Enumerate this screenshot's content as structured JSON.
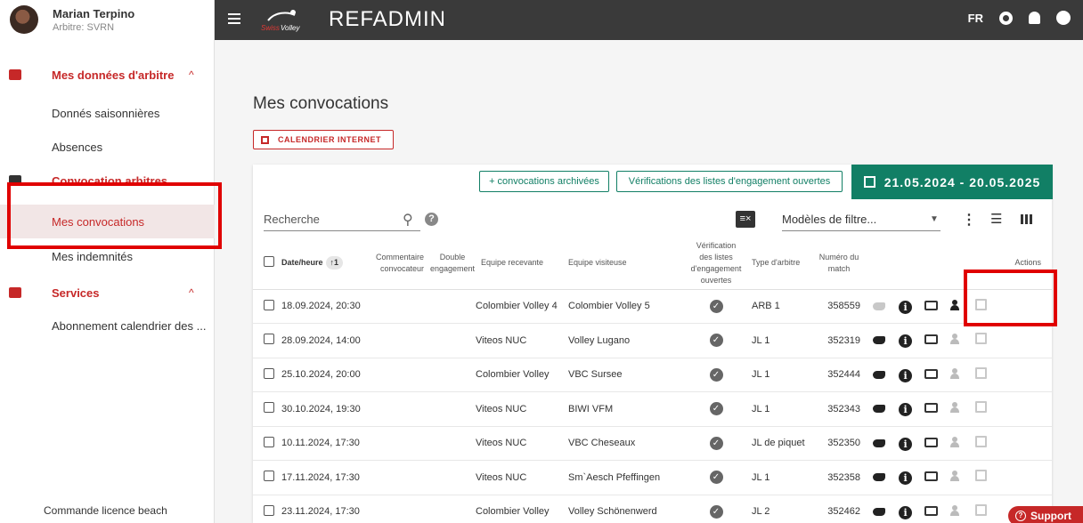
{
  "user": {
    "name": "Marian Terpino",
    "role": "Arbitre: SVRN"
  },
  "sidebar": {
    "sections": [
      {
        "title": "Mes données d'arbitre",
        "items": [
          "Donnés saisonnières",
          "Absences"
        ]
      },
      {
        "title": "Convocation arbitres",
        "items": [
          "Mes convocations",
          "Mes indemnités"
        ]
      },
      {
        "title": "Services",
        "items": [
          "Abonnement calendrier des ..."
        ]
      }
    ],
    "bottom": "Commande licence beach"
  },
  "topbar": {
    "app_name": "REFADMIN",
    "logo_text": "SwissVolley",
    "lang": "FR"
  },
  "page": {
    "title": "Mes convocations",
    "calendar_button": "CALENDRIER INTERNET"
  },
  "toolbar": {
    "archived_button": "+ convocations archivées",
    "verify_button": "Vérifications des listes d'engagement ouvertes",
    "date_range": "21.05.2024 - 20.05.2025",
    "search_placeholder": "Recherche",
    "filter_models": "Modèles de filtre..."
  },
  "table": {
    "headers": {
      "date": "Date/heure",
      "sort_badge": "↑1",
      "comment": "Commentaire convocateur",
      "double": "Double engagement",
      "home": "Equipe recevante",
      "away": "Equipe visiteuse",
      "verification": "Vérification des listes d'engagement ouvertes",
      "type": "Type d'arbitre",
      "match_no": "Numéro du match",
      "actions": "Actions"
    },
    "rows": [
      {
        "date": "18.09.2024, 20:30",
        "home": "Colombier Volley 4",
        "away": "Colombier Volley 5",
        "type": "ARB 1",
        "match": "358559"
      },
      {
        "date": "28.09.2024, 14:00",
        "home": "Viteos NUC",
        "away": "Volley Lugano",
        "type": "JL 1",
        "match": "352319"
      },
      {
        "date": "25.10.2024, 20:00",
        "home": "Colombier Volley",
        "away": "VBC Sursee",
        "type": "JL 1",
        "match": "352444"
      },
      {
        "date": "30.10.2024, 19:30",
        "home": "Viteos NUC",
        "away": "BIWI VFM",
        "type": "JL 1",
        "match": "352343"
      },
      {
        "date": "10.11.2024, 17:30",
        "home": "Viteos NUC",
        "away": "VBC Cheseaux",
        "type": "JL de piquet",
        "match": "352350"
      },
      {
        "date": "17.11.2024, 17:30",
        "home": "Viteos NUC",
        "away": "Sm`Aesch Pfeffingen",
        "type": "JL 1",
        "match": "352358"
      },
      {
        "date": "23.11.2024, 17:30",
        "home": "Colombier Volley",
        "away": "Volley Schönenwerd",
        "type": "JL 2",
        "match": "352462"
      }
    ]
  },
  "support": {
    "label": "Support"
  },
  "colors": {
    "accent": "#c62828",
    "topbar": "#3a3a3a",
    "green": "#117f65",
    "highlight": "#e00000"
  }
}
